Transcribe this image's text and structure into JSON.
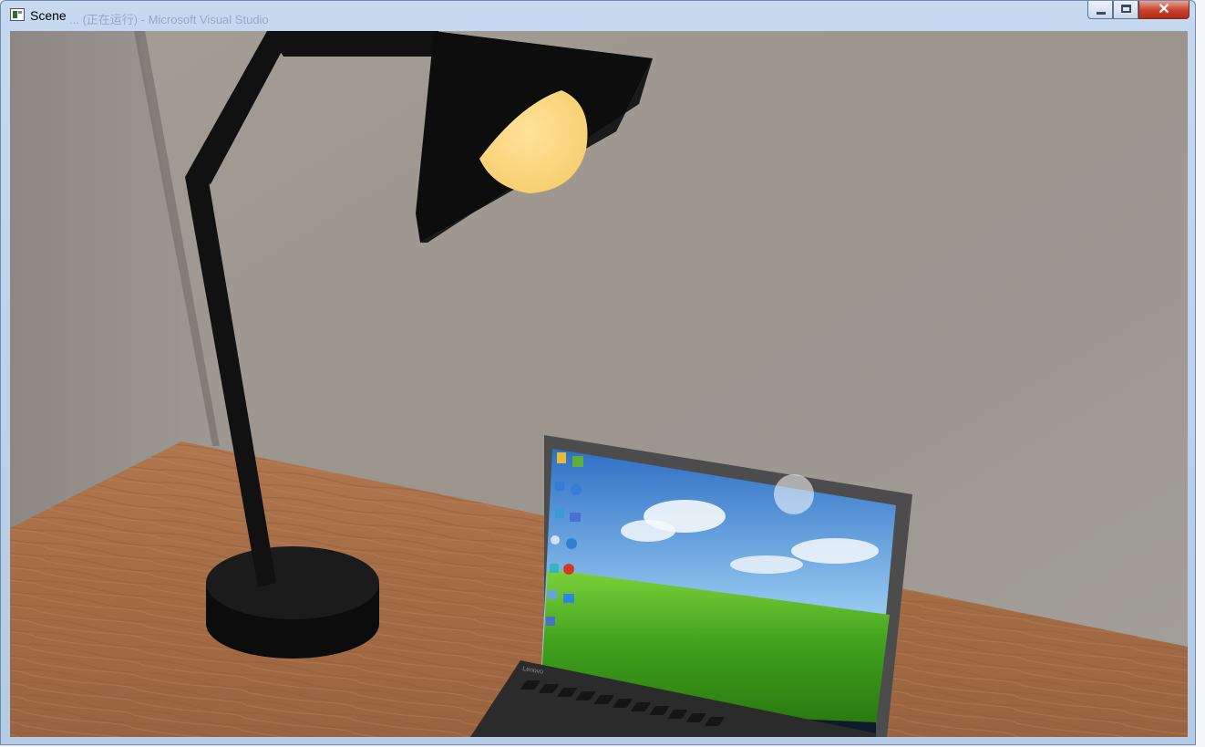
{
  "window": {
    "title": "Scene",
    "background_title": "... (正在运行) - Microsoft Visual Studio",
    "controls": {
      "minimize_icon": "minimize-icon",
      "maximize_icon": "maximize-icon",
      "close_icon": "close-icon",
      "close_glyph": "✕"
    }
  },
  "scene": {
    "objects": [
      "desk-lamp",
      "lamp-bulb",
      "laptop",
      "wooden-desk",
      "wall"
    ],
    "laptop_brand": "Lenovo",
    "bulb_color": "#ffd77a",
    "desk_color": "#a86f4a",
    "wall_color": "#9e9891",
    "lamp_color": "#111111"
  }
}
